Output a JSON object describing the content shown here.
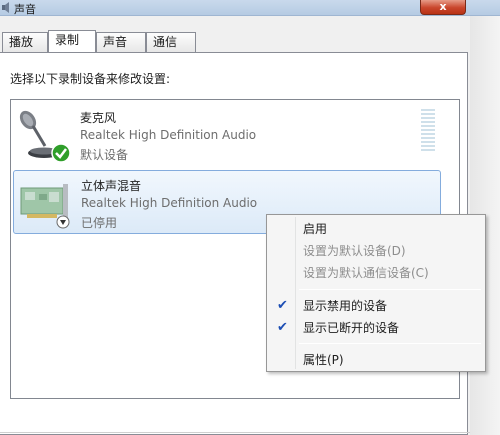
{
  "window": {
    "title": "声音",
    "close_label": "x"
  },
  "tabs": [
    {
      "label": "播放",
      "active": false
    },
    {
      "label": "录制",
      "active": true
    },
    {
      "label": "声音",
      "active": false
    },
    {
      "label": "通信",
      "active": false
    }
  ],
  "instruction": "选择以下录制设备来修改设置:",
  "devices": [
    {
      "name": "麦克风",
      "driver": "Realtek High Definition Audio",
      "status": "默认设备",
      "icon": "microphone-icon",
      "badge": "default-check-badge",
      "selected": false
    },
    {
      "name": "立体声混音",
      "driver": "Realtek High Definition Audio",
      "status": "已停用",
      "icon": "sound-card-icon",
      "badge": "disabled-arrow-badge",
      "selected": true
    }
  ],
  "context_menu": {
    "items": [
      {
        "label": "启用",
        "enabled": true,
        "checked": false
      },
      {
        "label": "设置为默认设备(D)",
        "enabled": false,
        "checked": false
      },
      {
        "label": "设置为默认通信设备(C)",
        "enabled": false,
        "checked": false
      },
      {
        "label": "显示禁用的设备",
        "enabled": true,
        "checked": true
      },
      {
        "label": "显示已断开的设备",
        "enabled": true,
        "checked": true
      },
      {
        "label": "属性(P)",
        "enabled": true,
        "checked": false
      }
    ]
  },
  "colors": {
    "selection_border": "#84acdd",
    "check_blue": "#1d4eb4",
    "badge_green": "#2f9e2a",
    "disabled_text": "#8d8d8d"
  }
}
